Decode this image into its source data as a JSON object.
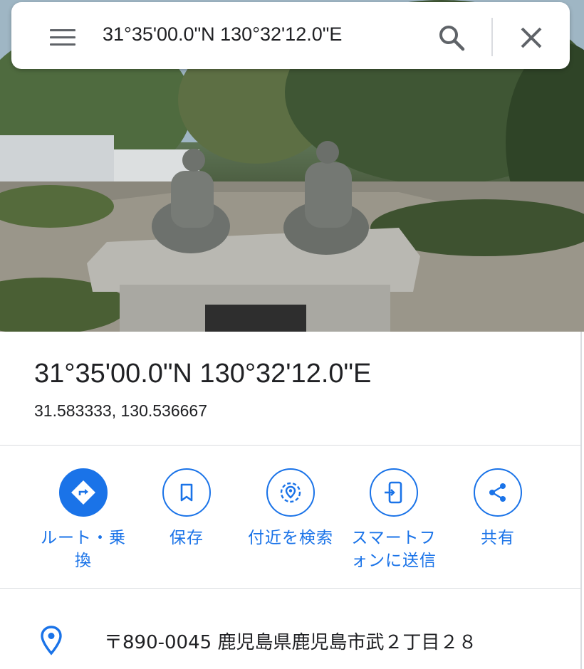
{
  "search": {
    "query": "31°35'00.0\"N 130°32'12.0\"E"
  },
  "hero": {
    "description_icon": "street-view-photo"
  },
  "place": {
    "title": "31°35'00.0\"N 130°32'12.0\"E",
    "decimal_coords": "31.583333, 130.536667"
  },
  "actions": [
    {
      "label": "ルート・乗換",
      "icon": "directions-icon"
    },
    {
      "label": "保存",
      "icon": "bookmark-icon"
    },
    {
      "label": "付近を検索",
      "icon": "nearby-search-icon"
    },
    {
      "label": "スマートフォンに送信",
      "icon": "send-to-phone-icon"
    },
    {
      "label": "共有",
      "icon": "share-icon"
    }
  ],
  "address": {
    "text": "〒890-0045 鹿児島県鹿児島市武２丁目２８"
  },
  "colors": {
    "accent": "#1a73e8",
    "text": "#202124",
    "icon_gray": "#5f6368",
    "divider": "#dadce0"
  }
}
